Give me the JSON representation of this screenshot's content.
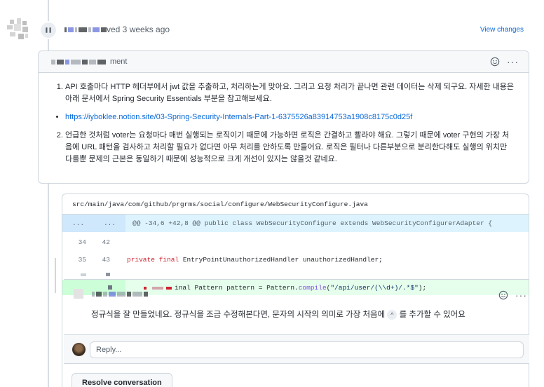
{
  "review": {
    "header_suffix": "ved 3 weeks ago",
    "view_changes": "View changes",
    "box_header_suffix": "ment",
    "items": [
      "API 호출마다 HTTP 헤더부에서 jwt 값을 추출하고, 처리하는게 맞아요. 그리고 요청 처리가 끝나면 관련 데이터는 삭제 되구요. 자세한 내용은 아래 문서에서 Spring Security Essentials 부분을 참고해보세요.",
      "언급한 것처럼 voter는 요청마다 매번 실행되는 로직이기 때문에 가능하면 로직은 간결하고 빨라야 해요. 그렇기 때문에 voter 구현의 가장 처음에 URL 패턴을 검사하고 처리할 필요가 없다면 아무 처리를 안하도록 만들어요. 로직은 필터나 다른부분으로 분리한다해도 실행의 위치만 다를뿐 문제의 근본은 동일하기 때문에 성능적으로 크게 개선이 있지는 않을것 같네요."
    ],
    "link": "https://iyboklee.notion.site/03-Spring-Security-Internals-Part-1-6375526a83914753a1908c8175c0d25f"
  },
  "diff": {
    "file_path": "src/main/java/com/github/prgrms/social/configure/WebSecurityConfigure.java",
    "hunk_left": "...",
    "hunk_right": "...",
    "hunk_header": "@@ -34,6 +42,8 @@ public class WebSecurityConfigure extends WebSecurityConfigurerAdapter {",
    "rows": [
      {
        "old": "34",
        "new": "42",
        "code": ""
      },
      {
        "old": "35",
        "new": "43",
        "code_kw": "private final",
        "code_rest": " EntryPointUnauthorizedHandler unauthorizedHandler;"
      }
    ],
    "added_code_prefix": "inal Pattern pattern = Pattern.",
    "added_code_fn": "compile",
    "added_code_open": "(",
    "added_code_str": "\"/api/user/(\\\\d+)/.*$\"",
    "added_code_close": ");"
  },
  "comment": {
    "text_before": "정규식을 잘 만들었네요. 정규식을 조금 수정해본다면, 문자의 시작의 의미로 가장 처음에 ",
    "caret": "^",
    "text_after": " 를 추가할 수 있어요"
  },
  "reply": {
    "placeholder": "Reply..."
  },
  "resolve_button": "Resolve conversation"
}
